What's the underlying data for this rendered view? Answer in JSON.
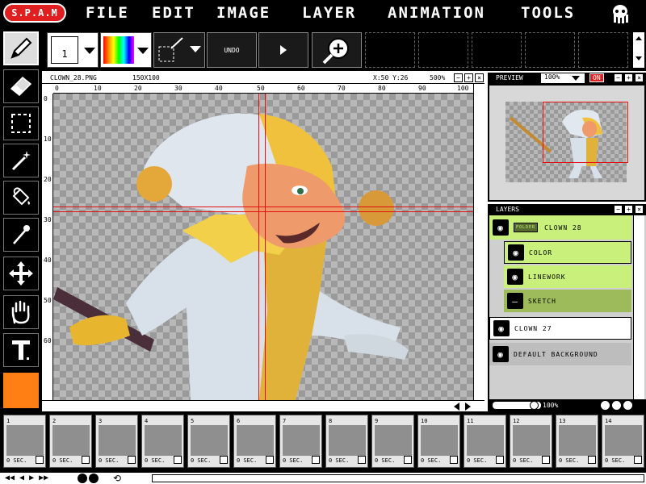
{
  "app": {
    "logo": "S.P.A.M",
    "menu": [
      "FILE",
      "EDIT",
      "IMAGE",
      "LAYER",
      "ANIMATION",
      "TOOLS"
    ]
  },
  "toolbar": {
    "brush_size": "1",
    "undo_label": "UNDO"
  },
  "document": {
    "filename": "CLOWN_28.PNG",
    "dimensions": "150X100",
    "cursor": "X:50 Y:26",
    "zoom": "500%",
    "ruler_h": [
      "0",
      "10",
      "20",
      "30",
      "40",
      "50",
      "60",
      "70",
      "80",
      "90",
      "100"
    ],
    "ruler_v": [
      "0",
      "10",
      "20",
      "30",
      "40",
      "50",
      "60"
    ]
  },
  "preview": {
    "title": "PREVIEW",
    "zoom": "100%",
    "toggle": "ON"
  },
  "layers": {
    "title": "LAYERS",
    "folder_badge": "FOLDER",
    "items": [
      {
        "label": "CLOWN 28",
        "kind": "folder"
      },
      {
        "label": "COLOR",
        "kind": "child"
      },
      {
        "label": "LINEWORK",
        "kind": "child"
      },
      {
        "label": "SKETCH",
        "kind": "child"
      },
      {
        "label": "CLOWN 27",
        "kind": "layer"
      },
      {
        "label": "DEFAULT BACKGROUND",
        "kind": "layer"
      }
    ],
    "opacity": "100%"
  },
  "timeline": {
    "frames": [
      {
        "num": "1",
        "sec": "0 SEC."
      },
      {
        "num": "2",
        "sec": "0 SEC."
      },
      {
        "num": "3",
        "sec": "0 SEC."
      },
      {
        "num": "4",
        "sec": "0 SEC."
      },
      {
        "num": "5",
        "sec": "0 SEC."
      },
      {
        "num": "6",
        "sec": "0 SEC."
      },
      {
        "num": "7",
        "sec": "0 SEC."
      },
      {
        "num": "8",
        "sec": "0 SEC."
      },
      {
        "num": "9",
        "sec": "0 SEC."
      },
      {
        "num": "10",
        "sec": "0 SEC."
      },
      {
        "num": "11",
        "sec": "0 SEC."
      },
      {
        "num": "12",
        "sec": "0 SEC."
      },
      {
        "num": "13",
        "sec": "0 SEC."
      },
      {
        "num": "14",
        "sec": "0 SEC."
      }
    ]
  },
  "colors": {
    "accent_red": "#e02020",
    "layer_green": "#c8f07a",
    "primary_color": "#ff7f15"
  }
}
